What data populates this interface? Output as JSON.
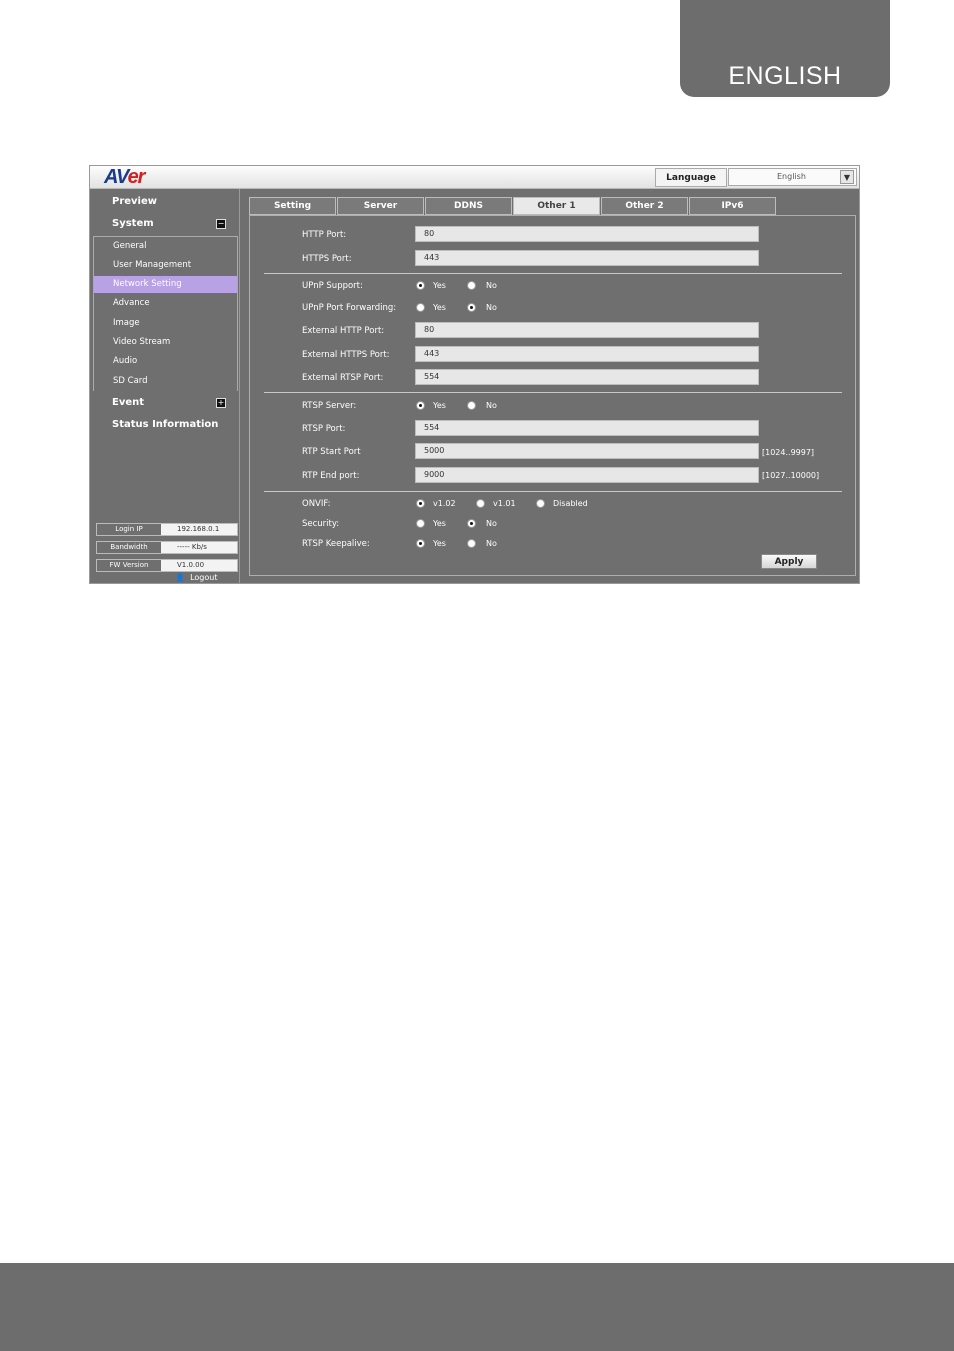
{
  "doc": {
    "language_tab": "ENGLISH"
  },
  "app": {
    "logo": "AVer",
    "language_label": "Language",
    "language_value": "English"
  },
  "sidebar": {
    "preview": "Preview",
    "system": "System",
    "items": [
      {
        "label": "General"
      },
      {
        "label": "User Management"
      },
      {
        "label": "Network Setting"
      },
      {
        "label": "Advance"
      },
      {
        "label": "Image"
      },
      {
        "label": "Video Stream"
      },
      {
        "label": "Audio"
      },
      {
        "label": "SD Card"
      }
    ],
    "active_item": "Network Setting",
    "event": "Event",
    "status_information": "Status Information",
    "status": {
      "login_ip_label": "Login IP",
      "login_ip_value": "192.168.0.1",
      "bandwidth_label": "Bandwidth",
      "bandwidth_value": "----- Kb/s",
      "fw_label": "FW Version",
      "fw_value": "V1.0.00"
    },
    "logout": "Logout"
  },
  "tabs": [
    {
      "label": "Setting"
    },
    {
      "label": "Server"
    },
    {
      "label": "DDNS"
    },
    {
      "label": "Other 1"
    },
    {
      "label": "Other 2"
    },
    {
      "label": "IPv6"
    }
  ],
  "active_tab": "Other 1",
  "form": {
    "http_port_label": "HTTP Port:",
    "http_port": "80",
    "https_port_label": "HTTPS Port:",
    "https_port": "443",
    "upnp_support_label": "UPnP Support:",
    "upnp_port_forwarding_label": "UPnP Port Forwarding:",
    "ext_http_label": "External HTTP Port:",
    "ext_http": "80",
    "ext_https_label": "External HTTPS Port:",
    "ext_https": "443",
    "ext_rtsp_label": "External RTSP Port:",
    "ext_rtsp": "554",
    "rtsp_server_label": "RTSP Server:",
    "rtsp_port_label": "RTSP Port:",
    "rtsp_port": "554",
    "rtp_start_label": "RTP Start Port",
    "rtp_start": "5000",
    "rtp_start_hint": "[1024..9997]",
    "rtp_end_label": "RTP End port:",
    "rtp_end": "9000",
    "rtp_end_hint": "[1027..10000]",
    "onvif_label": "ONVIF:",
    "security_label": "Security:",
    "rtsp_keepalive_label": "RTSP Keepalive:",
    "yes": "Yes",
    "no": "No",
    "onvif_v102": "v1.02",
    "onvif_v101": "v1.01",
    "onvif_disabled": "Disabled",
    "apply": "Apply"
  }
}
